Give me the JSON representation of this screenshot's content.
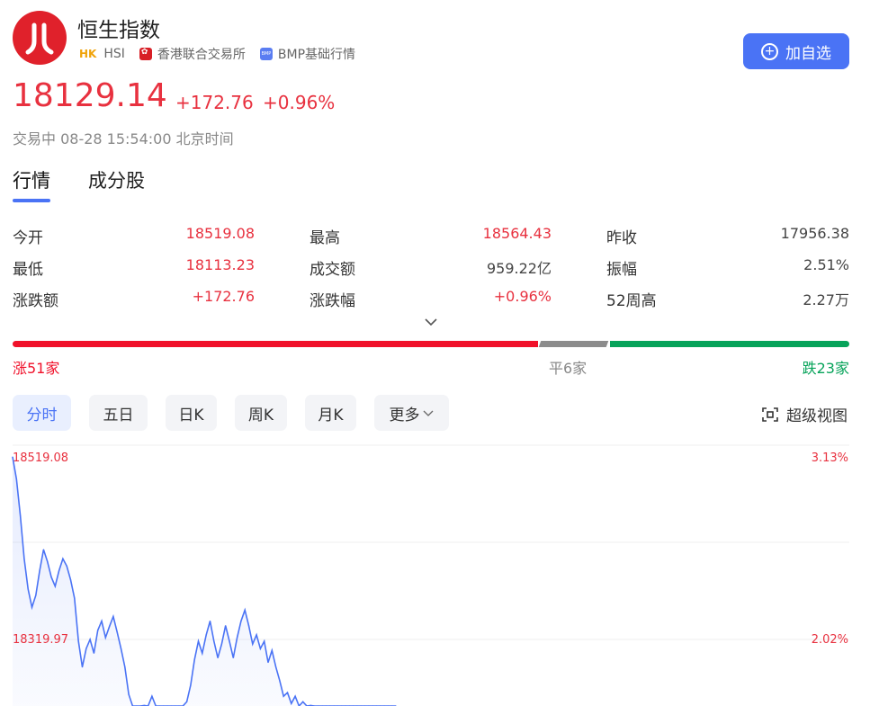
{
  "header": {
    "logo_glyph": "八",
    "title": "恒生指数",
    "market_badge": "HK",
    "code": "HSI",
    "exchange": "香港联合交易所",
    "bmp_icon_text": "BMP",
    "data_source": "BMP基础行情",
    "add_button_label": "加自选"
  },
  "quote": {
    "price": "18129.14",
    "change": "+172.76",
    "change_pct": "+0.96%",
    "status": "交易中 08-28 15:54:00 北京时间"
  },
  "tabs": [
    {
      "label": "行情",
      "active": true
    },
    {
      "label": "成分股",
      "active": false
    }
  ],
  "stats": [
    {
      "label": "今开",
      "value": "18519.08",
      "tone": "red"
    },
    {
      "label": "最高",
      "value": "18564.43",
      "tone": "red"
    },
    {
      "label": "昨收",
      "value": "17956.38",
      "tone": "dark"
    },
    {
      "label": "最低",
      "value": "18113.23",
      "tone": "red"
    },
    {
      "label": "成交额",
      "value": "959.22亿",
      "tone": "dark"
    },
    {
      "label": "振幅",
      "value": "2.51%",
      "tone": "dark"
    },
    {
      "label": "涨跌额",
      "value": "+172.76",
      "tone": "red"
    },
    {
      "label": "涨跌幅",
      "value": "+0.96%",
      "tone": "red"
    },
    {
      "label": "52周高",
      "value": "2.27万",
      "tone": "dark"
    }
  ],
  "breadth": {
    "up_label": "涨51家",
    "flat_label": "平6家",
    "down_label": "跌23家",
    "up": 51,
    "flat": 6,
    "down": 23
  },
  "periods": [
    {
      "label": "分时",
      "active": true
    },
    {
      "label": "五日",
      "active": false
    },
    {
      "label": "日K",
      "active": false
    },
    {
      "label": "周K",
      "active": false
    },
    {
      "label": "月K",
      "active": false
    },
    {
      "label": "更多",
      "active": false
    }
  ],
  "super_view_label": "超级视图",
  "colors": {
    "accent": "#4a73f5",
    "up": "#e8313f",
    "down": "#07a35a",
    "flat": "#8c8c8c"
  },
  "chart_data": {
    "type": "line",
    "y_left_ticks": [
      "18519.08",
      "18319.97"
    ],
    "y_right_ticks": [
      "3.13%",
      "2.02%"
    ],
    "ylim": [
      18110,
      18519.08
    ],
    "series": [
      {
        "values": [
          18519,
          18495,
          18455,
          18408,
          18375,
          18355,
          18368,
          18395,
          18418,
          18405,
          18388,
          18378,
          18395,
          18408,
          18400,
          18385,
          18365,
          18318,
          18290,
          18310,
          18320,
          18305,
          18330,
          18340,
          18322,
          18334,
          18345,
          18328,
          18310,
          18290,
          18260,
          18225,
          18205,
          18230,
          18248,
          18235,
          18258,
          18242,
          18215,
          18190,
          18210,
          18202,
          18225,
          18240,
          18228,
          18252,
          18270,
          18298,
          18318,
          18305,
          18325,
          18340,
          18318,
          18300,
          18315,
          18335,
          18318,
          18300,
          18322,
          18340,
          18352,
          18335,
          18315,
          18325,
          18310,
          18318,
          18295,
          18308,
          18290,
          18275,
          18258,
          18262,
          18250,
          18258,
          18244,
          18252,
          18240,
          18248,
          18238,
          18242,
          18232,
          18238,
          18230,
          18232,
          18222,
          18218,
          18226,
          18215,
          18220,
          18208,
          18212,
          18200,
          18206,
          18194,
          18198,
          18190,
          18180,
          18170,
          18150,
          18125
        ]
      }
    ]
  }
}
